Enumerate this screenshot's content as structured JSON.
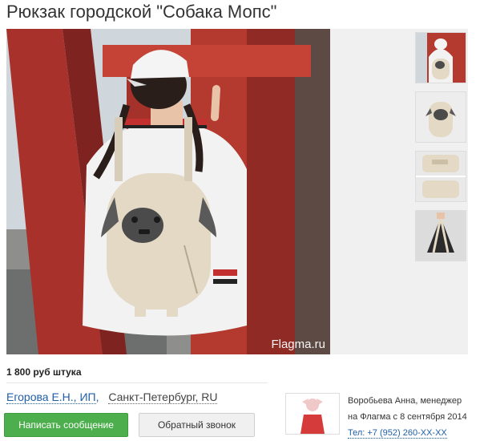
{
  "product": {
    "title": "Рюкзак городской \"Собака Мопс\"",
    "watermark": "Flagma.ru",
    "price": "1 800 руб штука"
  },
  "gallery": {
    "thumbnails": [
      "thumb-backpack-back",
      "thumb-backpack-front",
      "thumb-backpack-open",
      "thumb-backpack-black"
    ]
  },
  "seller": {
    "name": "Егорова Е.Н., ИП",
    "comma": ",",
    "city": "Санкт-Петербург, RU"
  },
  "actions": {
    "message_label": "Написать сообщение",
    "callback_label": "Обратный звонок"
  },
  "manager": {
    "line1": "Воробьева Анна, менеджер",
    "line2": "на Флагма с 8 сентября 2014",
    "phone": "Тел: +7 (952) 260-XX-XX"
  },
  "colors": {
    "accent_green": "#4cae4c",
    "link_blue": "#1f5fa8",
    "pillar_red": "#b23a2e"
  }
}
